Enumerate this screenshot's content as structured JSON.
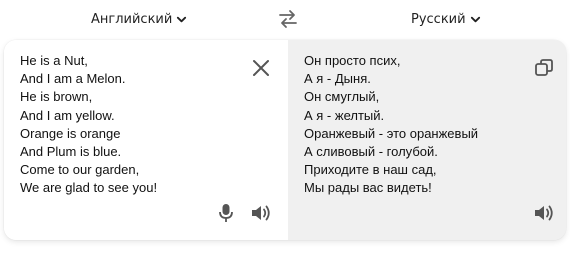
{
  "header": {
    "source_language": "Английский",
    "target_language": "Русский"
  },
  "source": {
    "text": "He is a Nut,\nAnd I am a Melon.\nHe is brown,\nAnd I am yellow.\nOrange is orange\nAnd Plum is blue.\nCome to our garden,\nWe are glad to see you!"
  },
  "translation": {
    "text": "Он просто псих,\nА я - Дыня.\nОн смуглый,\nА я - желтый.\nОранжевый - это оранжевый\nА сливовый - голубой.\nПриходите в наш сад,\nМы рады вас видеть!"
  },
  "icons": {
    "source_chevron": "chevron-down-icon",
    "target_chevron": "chevron-down-icon",
    "swap": "swap-arrows-icon",
    "clear": "close-icon",
    "mic": "microphone-icon",
    "speak_source": "speaker-icon",
    "copy": "copy-icon",
    "speak_target": "speaker-icon"
  },
  "colors": {
    "icon": "#555555",
    "translation_bg": "#f0f0f0",
    "text": "#111111"
  }
}
